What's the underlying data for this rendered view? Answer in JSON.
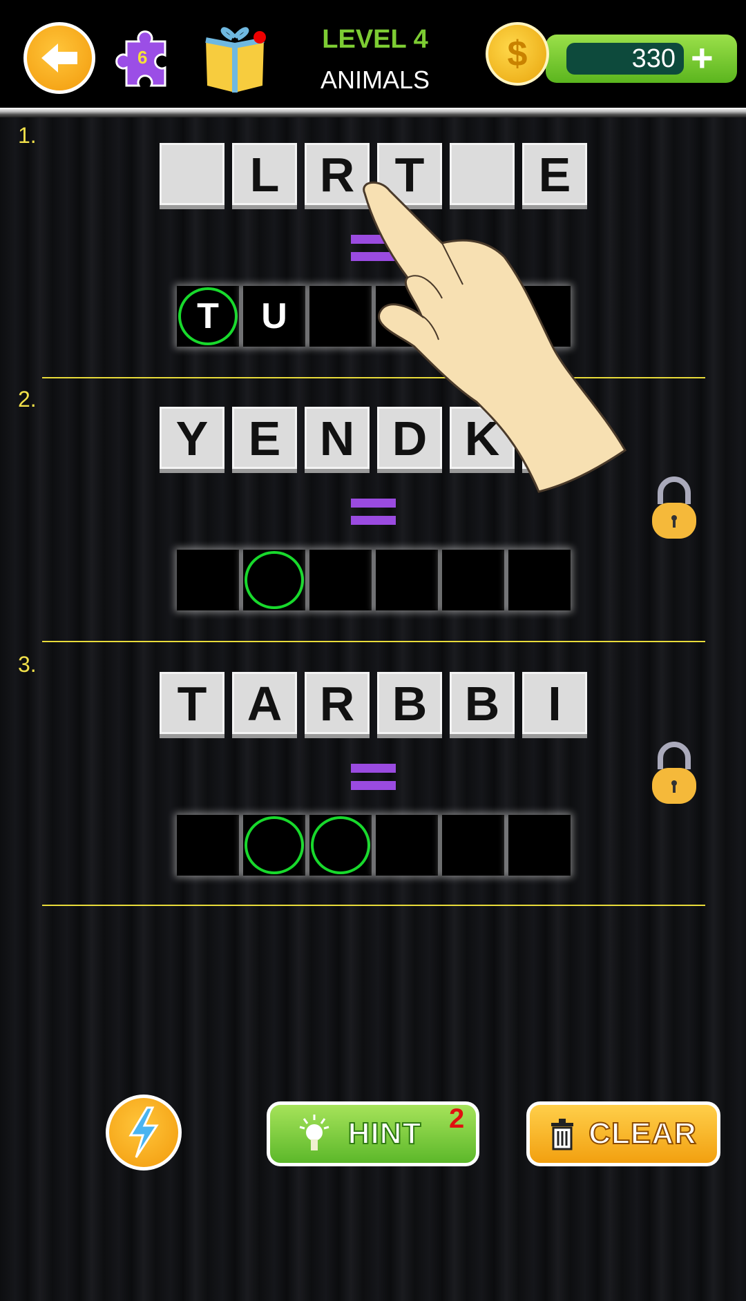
{
  "header": {
    "level": "LEVEL 4",
    "category": "ANIMALS",
    "puzzle_count": "6",
    "coins": "330",
    "colors": {
      "level": "#7dcc33",
      "coin_bar": "#5bb51e"
    }
  },
  "puzzles": [
    {
      "number": "1.",
      "tiles": [
        "",
        "L",
        "R",
        "T",
        "",
        "E"
      ],
      "answer": [
        "T",
        "U",
        "",
        "",
        "",
        ""
      ],
      "highlighted": [
        0
      ],
      "locked": false
    },
    {
      "number": "2.",
      "tiles": [
        "Y",
        "E",
        "N",
        "D",
        "K",
        ""
      ],
      "answer": [
        "",
        "",
        "",
        "",
        "",
        ""
      ],
      "highlighted": [
        1
      ],
      "locked": true
    },
    {
      "number": "3.",
      "tiles": [
        "T",
        "A",
        "R",
        "B",
        "B",
        "I"
      ],
      "answer": [
        "",
        "",
        "",
        "",
        "",
        ""
      ],
      "highlighted": [
        1,
        2
      ],
      "locked": true
    }
  ],
  "buttons": {
    "hint": "HINT",
    "hint_count": "2",
    "clear": "CLEAR"
  },
  "icons": [
    "back-arrow-icon",
    "puzzle-piece-icon",
    "gift-icon",
    "coin-icon",
    "plus-icon",
    "lock-icon",
    "lightning-icon",
    "lightbulb-icon",
    "trash-icon",
    "hand-pointer-icon"
  ]
}
